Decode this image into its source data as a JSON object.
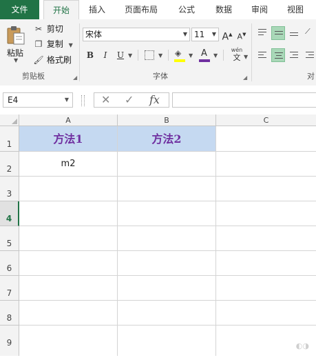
{
  "ribbon": {
    "tabs": [
      "文件",
      "开始",
      "插入",
      "页面布局",
      "公式",
      "数据",
      "审阅",
      "视图"
    ],
    "clipboard": {
      "paste": "粘贴",
      "cut": "剪切",
      "copy": "复制",
      "format_painter": "格式刷",
      "group_label": "剪贴板"
    },
    "font": {
      "name": "宋体",
      "size": "11",
      "bold": "B",
      "italic": "I",
      "underline": "U",
      "grow": "A",
      "shrink": "A",
      "font_color": "A",
      "phonetic": "wén",
      "phonetic_char": "文",
      "group_label": "字体"
    },
    "alignment": {
      "group_label": "对"
    }
  },
  "formula_bar": {
    "name_box": "E4",
    "cancel": "✕",
    "enter": "✓",
    "fx": "fx",
    "value": ""
  },
  "sheet": {
    "columns": [
      "A",
      "B",
      "C"
    ],
    "rows": [
      "1",
      "2",
      "3",
      "4",
      "5",
      "6",
      "7",
      "8",
      "9"
    ],
    "selected_row": "4",
    "cells": {
      "A1": "方法1",
      "B1": "方法2",
      "A2": "m2"
    }
  },
  "colors": {
    "accent": "#217346",
    "header_fill": "#c5d9f1",
    "header_text": "#7030a0"
  }
}
